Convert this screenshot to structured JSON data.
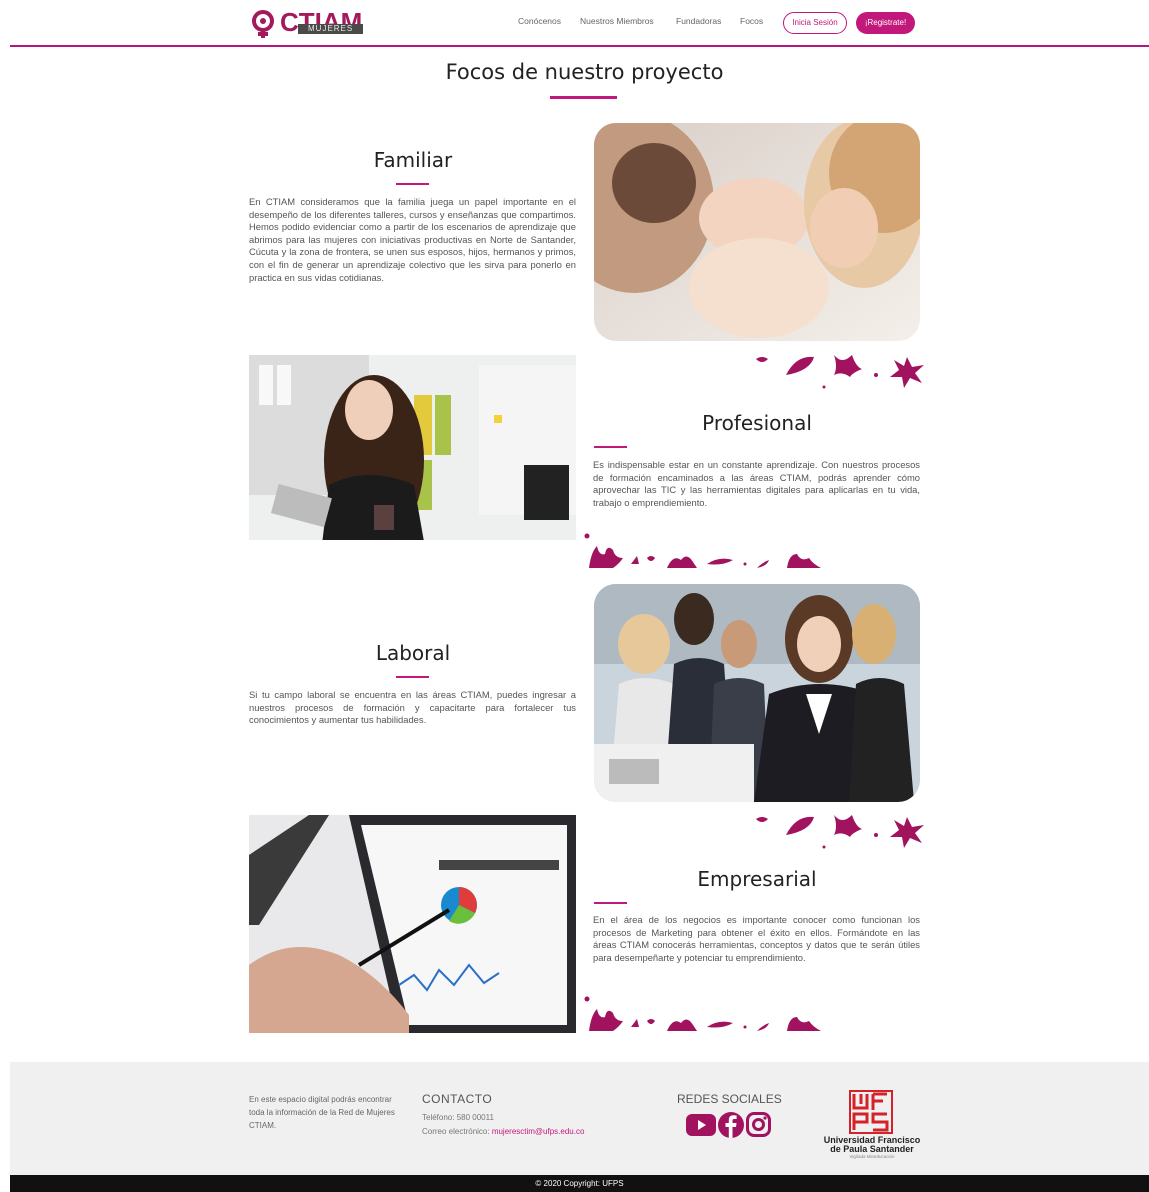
{
  "header": {
    "logo_text": "CTIAM",
    "logo_sub": "MUJERES",
    "nav": [
      "Conócenos",
      "Nuestros Miembros",
      "Fundadoras",
      "Focos"
    ],
    "login_label": "Inicia Sesión",
    "register_label": "¡Registrate!"
  },
  "main": {
    "title": "Focos de nuestro proyecto",
    "sections": [
      {
        "title": "Familiar",
        "text": "En CTIAM consideramos que la familia juega un papel importante en el desempeño de los diferentes talleres, cursos y enseñanzas que compartimos. Hemos podido evidenciar como a partir de los escenarios de aprendizaje que abrimos para las mujeres con iniciativas productivas en Norte de Santander, Cúcuta y la zona de frontera, se unen sus esposos, hijos, hermanos y primos, con el fin de generar un aprendizaje colectivo que les sirva para ponerlo en practica en sus vidas cotidianas."
      },
      {
        "title": "Profesional",
        "text": "Es indispensable estar en un constante aprendizaje. Con nuestros procesos de formación encaminados a las áreas CTIAM, podrás aprender cómo aprovechar las TIC y las herramientas digitales para aplicarlas en tu vida, trabajo o emprendiemiento."
      },
      {
        "title": "Laboral",
        "text": "Si tu campo laboral se encuentra en las áreas CTIAM, puedes ingresar a nuestros procesos de formación y capacitarte para fortalecer tus conocimientos y aumentar tus habilidades."
      },
      {
        "title": "Empresarial",
        "text": "En el área de los negocios es importante conocer como funcionan los procesos de Marketing para obtener el éxito en ellos. Formándote en las áreas CTIAM conocerás herramientas, conceptos y datos que te serán útiles para desempeñarte y potenciar tu emprendimiento."
      }
    ]
  },
  "footer": {
    "about": "En este espacio digital podrás encontrar toda la información de la Red de Mujeres CTIAM.",
    "contact_title": "CONTACTO",
    "phone": "Teléfono: 580 00011",
    "email_label": "Correo electrónico: ",
    "email": "mujeresctim@ufps.edu.co",
    "social_title": "REDES SOCIALES",
    "university_line1": "Universidad Francisco",
    "university_line2": "de Paula Santander",
    "university_line3": "Vigilada Mineducación",
    "copyright": "© 2020 Copyright: UFPS"
  },
  "colors": {
    "accent": "#c2187b",
    "logo": "#a3195b",
    "ufps_red": "#d3222a",
    "footer_bg": "#f0f0f0",
    "copyright_bg": "#111111"
  },
  "icons": [
    "venus-logo-icon",
    "flower-decoration-icon",
    "youtube-icon",
    "facebook-icon",
    "instagram-icon",
    "ufps-logo-icon"
  ]
}
